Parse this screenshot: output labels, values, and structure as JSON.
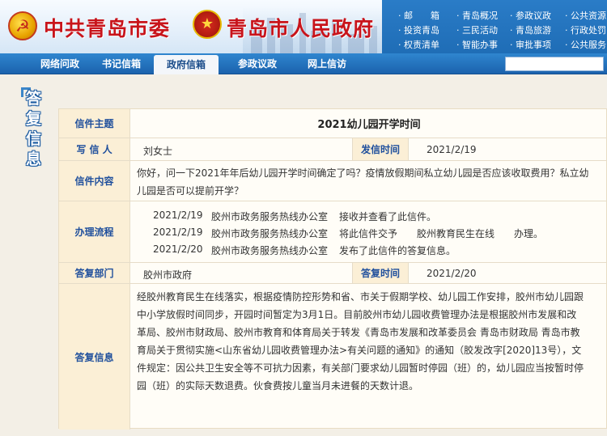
{
  "banner": {
    "party_title": "中共青岛市委",
    "gov_title": "青岛市人民政府",
    "quick_links": [
      "· 邮　　箱",
      "· 青岛概况",
      "· 参政议政",
      "· 公共资源",
      "· 投资青岛",
      "· 三民活动",
      "· 青岛旅游",
      "· 行政处罚",
      "· 权责清单",
      "· 智能办事",
      "· 审批事项",
      "· 公共服务"
    ]
  },
  "nav": {
    "items": [
      "网络问政",
      "书记信箱",
      "政府信箱",
      "参政议政",
      "网上信访"
    ],
    "active_index": 2
  },
  "side_label": [
    "答",
    "复",
    "信",
    "息"
  ],
  "letter": {
    "subject_label": "信件主题",
    "subject": "2021幼儿园开学时间",
    "writer_label": "写 信 人",
    "writer": "刘女士",
    "send_time_label": "发信时间",
    "send_time": "2021/2/19",
    "content_label": "信件内容",
    "content": "你好，问一下2021年年后幼儿园开学时间确定了吗？疫情放假期间私立幼儿园是否应该收取费用？私立幼儿园是否可以提前开学？",
    "process_label": "办理流程",
    "process": [
      {
        "date": "2021/2/19",
        "dept": "胶州市政务服务热线办公室",
        "action": "接收并查看了此信件。"
      },
      {
        "date": "2021/2/19",
        "dept": "胶州市政务服务热线办公室",
        "action": "将此信件交予　　胶州教育民生在线　　办理。"
      },
      {
        "date": "2021/2/20",
        "dept": "胶州市政务服务热线办公室",
        "action": "发布了此信件的答复信息。"
      }
    ],
    "reply_dept_label": "答复部门",
    "reply_dept": "胶州市政府",
    "reply_time_label": "答复时间",
    "reply_time": "2021/2/20",
    "reply_label": "答复信息",
    "reply": "经胶州教育民生在线落实，根据疫情防控形势和省、市关于假期学校、幼儿园工作安排，胶州市幼儿园跟中小学放假时间同步，开园时间暂定为3月1日。目前胶州市幼儿园收费管理办法是根据胶州市发展和改革局、胶州市财政局、胶州市教育和体育局关于转发《青岛市发展和改革委员会 青岛市财政局 青岛市教育局关于贯彻实施<山东省幼儿园收费管理办法>有关问题的通知》的通知（胶发改字[2020]13号），文件规定：因公共卫生安全等不可抗力因素，有关部门要求幼儿园暂时停园（班）的，幼儿园应当按暂时停园（班）的实际天数退费。伙食费按儿童当月未进餐的天数计退。"
  }
}
